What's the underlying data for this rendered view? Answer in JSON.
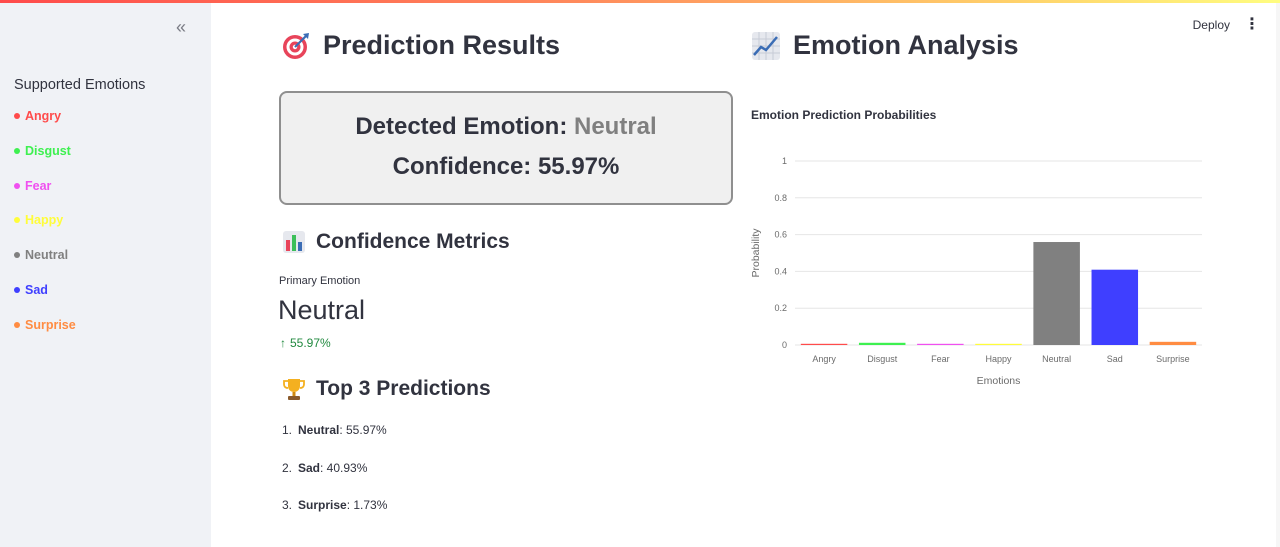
{
  "sidebar": {
    "collapse_glyph": "«",
    "title": "Supported Emotions",
    "emotions": [
      {
        "label": "Angry",
        "color": "#ff4b4b"
      },
      {
        "label": "Disgust",
        "color": "#3ef050"
      },
      {
        "label": "Fear",
        "color": "#f050f0"
      },
      {
        "label": "Happy",
        "color": "#fffd3a"
      },
      {
        "label": "Neutral",
        "color": "#808080"
      },
      {
        "label": "Sad",
        "color": "#3f3fff"
      },
      {
        "label": "Surprise",
        "color": "#ff8c42"
      }
    ]
  },
  "header": {
    "deploy_label": "Deploy",
    "menu_glyph": "⋮"
  },
  "prediction": {
    "title": "Prediction Results",
    "detected_label": "Detected Emotion:",
    "detected_value": "Neutral",
    "confidence_text": "Confidence: 55.97%"
  },
  "metrics": {
    "title": "Confidence Metrics",
    "label": "Primary Emotion",
    "value": "Neutral",
    "delta": "55.97%",
    "delta_arrow": "↑"
  },
  "top3": {
    "title": "Top 3 Predictions",
    "items": [
      {
        "num": "1.",
        "name": "Neutral",
        "value": ": 55.97%"
      },
      {
        "num": "2.",
        "name": "Sad",
        "value": ": 40.93%"
      },
      {
        "num": "3.",
        "name": "Surprise",
        "value": ": 1.73%"
      }
    ]
  },
  "analysis": {
    "title": "Emotion Analysis"
  },
  "chart_data": {
    "type": "bar",
    "title": "Emotion Prediction Probabilities",
    "xlabel": "Emotions",
    "ylabel": "Probability",
    "categories": [
      "Angry",
      "Disgust",
      "Fear",
      "Happy",
      "Neutral",
      "Sad",
      "Surprise"
    ],
    "values": [
      0.005,
      0.012,
      0.004,
      0.003,
      0.5597,
      0.4093,
      0.0173
    ],
    "colors": [
      "#ff4b4b",
      "#3ef050",
      "#f050f0",
      "#fffd3a",
      "#808080",
      "#3f3fff",
      "#ff8c42"
    ],
    "yticks": [
      "0",
      "0.2",
      "0.4",
      "0.6",
      "0.8",
      "1"
    ],
    "ylim": [
      0,
      1
    ],
    "grid": true
  }
}
